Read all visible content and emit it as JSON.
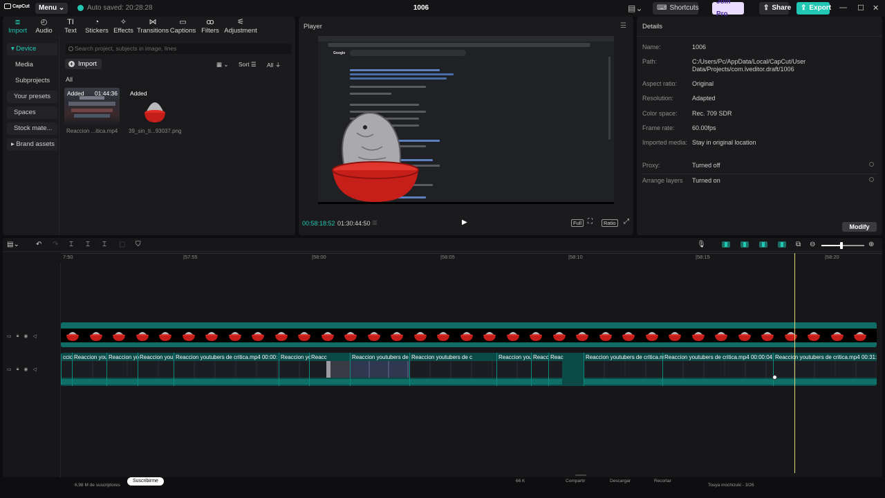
{
  "titlebar": {
    "logo": "CapCut",
    "menu": "Menu",
    "autosave": "Auto saved: 20:28:28",
    "project_title": "1006",
    "shortcuts": "Shortcuts",
    "join_pro": "Join Pro",
    "share": "Share",
    "export": "Export"
  },
  "media": {
    "tabs": [
      {
        "label": "Import",
        "icon": "import-icon"
      },
      {
        "label": "Audio",
        "icon": "audio-icon"
      },
      {
        "label": "Text",
        "icon": "text-icon"
      },
      {
        "label": "Stickers",
        "icon": "stickers-icon"
      },
      {
        "label": "Effects",
        "icon": "effects-icon"
      },
      {
        "label": "Transitions",
        "icon": "transitions-icon"
      },
      {
        "label": "Captions",
        "icon": "captions-icon"
      },
      {
        "label": "Filters",
        "icon": "filters-icon"
      },
      {
        "label": "Adjustment",
        "icon": "adjustment-icon"
      }
    ],
    "nav": [
      "Device",
      "Media",
      "Subprojects",
      "Your presets",
      "Spaces",
      "Stock mate...",
      "Brand assets"
    ],
    "search_placeholder": "Search project, subjects in image, lines",
    "import_btn": "Import",
    "sort": "Sort",
    "all_filter": "All",
    "all_label": "All",
    "items": [
      {
        "tag": "Added",
        "duration": "01:44:36",
        "name": "Reaccion ...itica.mp4"
      },
      {
        "tag": "Added",
        "duration": "",
        "name": "39_sin_ti...93037.png"
      }
    ]
  },
  "player": {
    "title": "Player",
    "current_time": "00:58:18:52",
    "total_time": "01:30:44:50",
    "full": "Full",
    "ratio": "Ratio",
    "screen_google": "Google"
  },
  "details": {
    "title": "Details",
    "rows": [
      {
        "k": "Name:",
        "v": "1006"
      },
      {
        "k": "Path:",
        "v": "C:/Users/Pc/AppData/Local/CapCut/User Data/Projects/com.lveditor.draft/1006"
      },
      {
        "k": "Aspect ratio:",
        "v": "Original"
      },
      {
        "k": "Resolution:",
        "v": "Adapted"
      },
      {
        "k": "Color space:",
        "v": "Rec. 709 SDR"
      },
      {
        "k": "Frame rate:",
        "v": "60.00fps"
      },
      {
        "k": "Imported media:",
        "v": "Stay in original location"
      }
    ],
    "proxy": {
      "k": "Proxy:",
      "v": "Turned off"
    },
    "arrange": {
      "k": "Arrange layers",
      "v": "Turned on"
    },
    "modify": "Modify"
  },
  "timeline": {
    "ruler": [
      "7:50",
      "|57:55",
      "|58:00",
      "|58:05",
      "|58:10",
      "|58:15",
      "|58:20"
    ],
    "clips": [
      {
        "label": "ccior"
      },
      {
        "label": "Reaccion you"
      },
      {
        "label": "Reaccion yo"
      },
      {
        "label": "Reaccion you"
      },
      {
        "label": "Reaccion youtubers de critica.mp4  00:00:"
      },
      {
        "label": "Reaccion yo"
      },
      {
        "label": "Reacc"
      },
      {
        "label": "Reaccion youtubers de"
      },
      {
        "label": "Reaccion youtubers de c"
      },
      {
        "label": "Reaccion you"
      },
      {
        "label": "Reacc"
      },
      {
        "label": "Reac"
      },
      {
        "label": "Reaccion youtubers de critica.m"
      },
      {
        "label": "Reaccion youtubers de critica.mp4  00:00:04"
      },
      {
        "label": "Reaccion youtubers de critica.mp4  00:31:"
      }
    ]
  },
  "background": {
    "subs": "6,98 M de suscriptores",
    "subscribe": "Suscribirme",
    "likes": "66 K",
    "share": "Compartir",
    "download": "Descargar",
    "clip": "Recortar",
    "playlist": "Touya mochizuki - 3/26"
  }
}
